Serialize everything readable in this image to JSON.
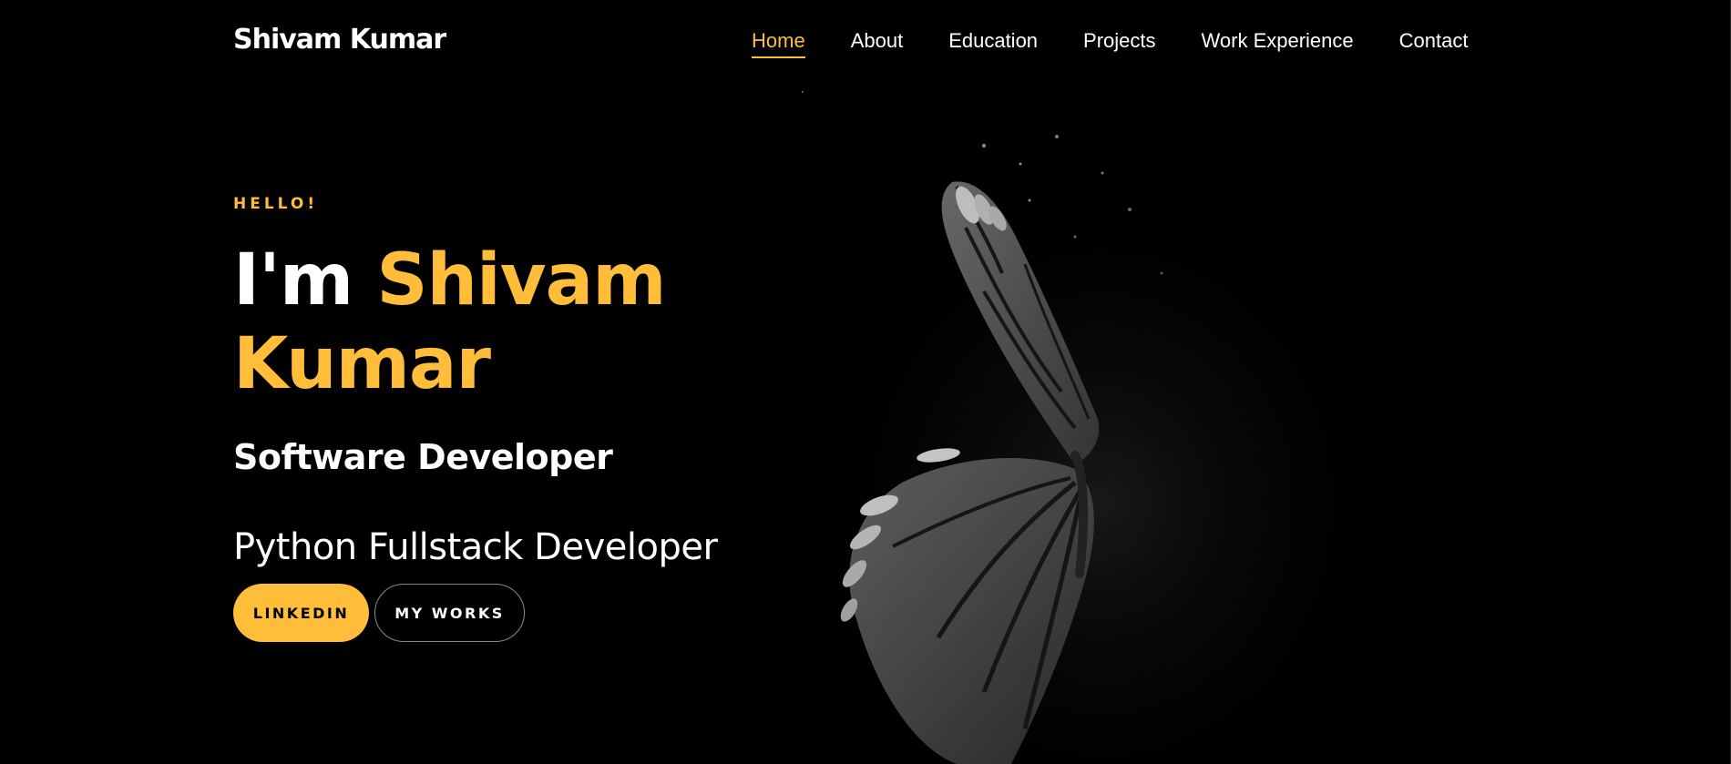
{
  "header": {
    "brand": "Shivam Kumar",
    "nav": [
      {
        "label": "Home",
        "active": true
      },
      {
        "label": "About",
        "active": false
      },
      {
        "label": "Education",
        "active": false
      },
      {
        "label": "Projects",
        "active": false
      },
      {
        "label": "Work Experience",
        "active": false
      },
      {
        "label": "Contact",
        "active": false
      }
    ]
  },
  "hero": {
    "greeting": "HELLO!",
    "title_prefix": "I'm ",
    "name_first": "Shivam",
    "name_last": "Kumar",
    "role": "Software Developer",
    "subrole": "Python Fullstack Developer",
    "buttons": {
      "primary": "LINKEDIN",
      "secondary": "MY WORKS"
    },
    "image_icon": "butterfly-illustration"
  },
  "colors": {
    "background": "#000000",
    "accent": "#ffbd39",
    "text": "#ffffff"
  }
}
